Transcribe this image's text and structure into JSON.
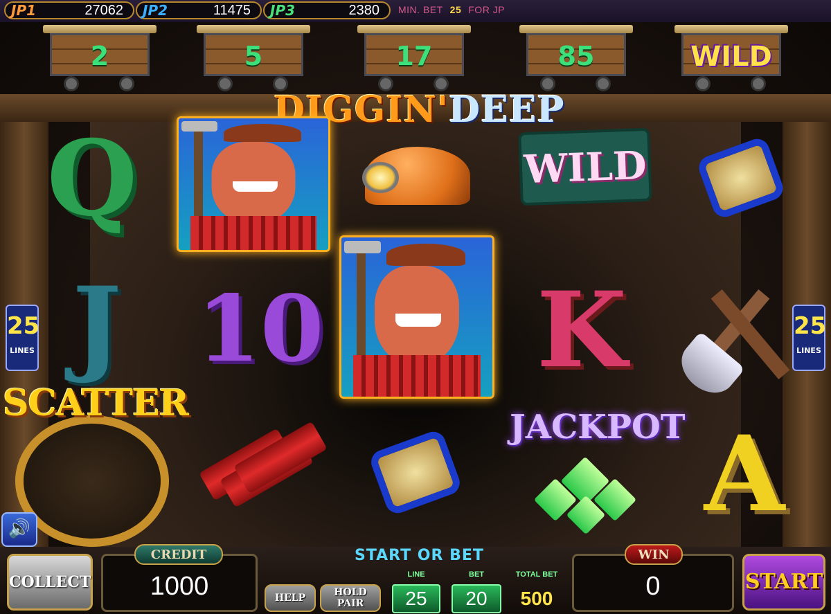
{
  "jackpots": [
    {
      "label": "JP1",
      "value": "27062",
      "color": "#ff9a3a"
    },
    {
      "label": "JP2",
      "value": "11475",
      "color": "#3ab0ff"
    },
    {
      "label": "JP3",
      "value": "2380",
      "color": "#4ae07a"
    }
  ],
  "min_bet": {
    "label": "MIN. BET",
    "value": "25",
    "suffix": "FOR JP"
  },
  "carts": [
    {
      "value": "2"
    },
    {
      "value": "5"
    },
    {
      "value": "17"
    },
    {
      "value": "85"
    },
    {
      "value": "WILD"
    }
  ],
  "logo": {
    "part1": "DIGGIN'",
    "part2": "DEEP"
  },
  "lines_indicator": {
    "value": "25",
    "label": "LINES"
  },
  "reels": {
    "reel1": [
      "Q",
      "J",
      "SCATTER"
    ],
    "reel2": [
      "miner",
      "10",
      "dynamite"
    ],
    "reel3": [
      "hard hat",
      "miner",
      "lantern"
    ],
    "reel4": [
      "WILD",
      "K",
      "JACKPOT"
    ],
    "reel5": [
      "lantern",
      "pick and shovel",
      "A"
    ]
  },
  "symbols": {
    "q": "Q",
    "j": "J",
    "ten": "10",
    "k": "K",
    "a": "A",
    "wild": "WILD",
    "scatter": "SCATTER",
    "jackpot": "JACKPOT"
  },
  "panel": {
    "collect": "COLLECT",
    "credit_label": "CREDIT",
    "credit_value": "1000",
    "help": "HELP",
    "hold_pair": "HOLD PAIR",
    "prompt": "START OR BET",
    "line_label": "LINE",
    "line_value": "25",
    "bet_label": "BET",
    "bet_value": "20",
    "total_bet_label": "TOTAL BET",
    "total_bet_value": "500",
    "win_label": "WIN",
    "win_value": "0",
    "start": "START"
  }
}
